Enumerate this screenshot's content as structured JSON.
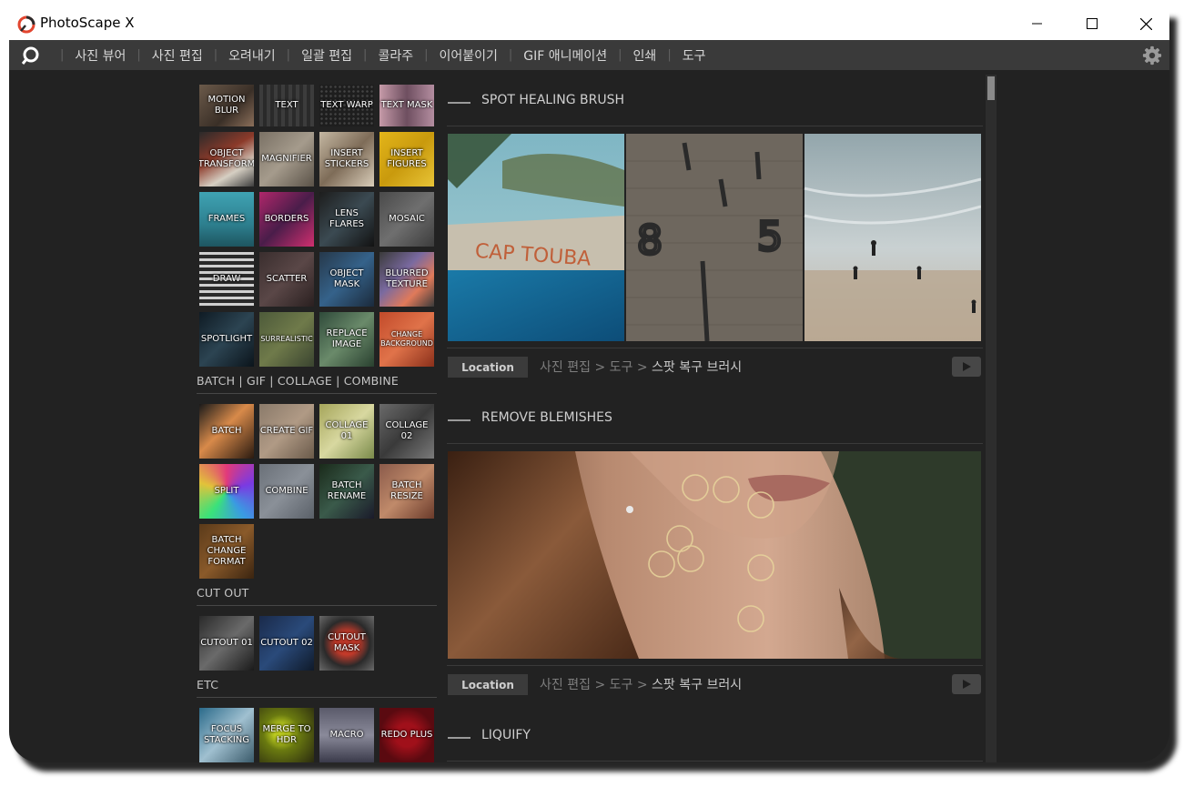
{
  "window": {
    "title": "PhotoScape X",
    "controls": {
      "minimize_icon": "minimize-icon",
      "maximize_icon": "maximize-icon",
      "close_icon": "close-icon"
    }
  },
  "menubar": {
    "items": [
      "사진 뷰어",
      "사진 편집",
      "오려내기",
      "일괄 편집",
      "콜라주",
      "이어붙이기",
      "GIF 애니메이션",
      "인쇄",
      "도구"
    ],
    "separator": "|"
  },
  "tools": {
    "rows": [
      [
        "MOTION BLUR",
        "TEXT",
        "TEXT WARP",
        "TEXT MASK"
      ],
      [
        "OBJECT TRANSFORM",
        "MAGNIFIER",
        "INSERT STICKERS",
        "INSERT FIGURES"
      ],
      [
        "FRAMES",
        "BORDERS",
        "LENS FLARES",
        "MOSAIC"
      ],
      [
        "DRAW",
        "SCATTER",
        "OBJECT MASK",
        "BLURRED TEXTURE"
      ],
      [
        "SPOTLIGHT",
        "SURREALISTIC",
        "REPLACE IMAGE",
        "CHANGE BACKGROUND"
      ]
    ]
  },
  "sections": {
    "batch": {
      "label": "BATCH | GIF | COLLAGE | COMBINE",
      "tiles": [
        "BATCH",
        "CREATE GIF",
        "COLLAGE 01",
        "COLLAGE 02",
        "SPLIT",
        "COMBINE",
        "BATCH RENAME",
        "BATCH RESIZE",
        "BATCH CHANGE FORMAT"
      ]
    },
    "cutout": {
      "label": "CUT OUT",
      "tiles": [
        "CUTOUT 01",
        "CUTOUT 02",
        "CUTOUT MASK"
      ]
    },
    "etc": {
      "label": "ETC",
      "tiles": [
        "FOCUS STACKING",
        "MERGE TO HDR",
        "MACRO",
        "REDO PLUS"
      ]
    }
  },
  "content": {
    "sections": [
      {
        "title": "SPOT HEALING BRUSH",
        "location_label": "Location",
        "path": [
          "사진 편집",
          "도구",
          "스팟 복구 브러시"
        ],
        "path_sep": ">"
      },
      {
        "title": "REMOVE BLEMISHES",
        "location_label": "Location",
        "path": [
          "사진 편집",
          "도구",
          "스팟 복구 브러시"
        ],
        "path_sep": ">"
      },
      {
        "title": "LIQUIFY"
      }
    ],
    "photo_text": {
      "cap_touba": "CAP TOUBA",
      "wall_numbers": [
        "8",
        "5"
      ]
    }
  },
  "colors": {
    "background": "#222222",
    "menubar": "#3a3a3a",
    "text": "#d8d8d8",
    "accent_logo": "#e2452f",
    "blemish_circle": "#e8d59c"
  }
}
